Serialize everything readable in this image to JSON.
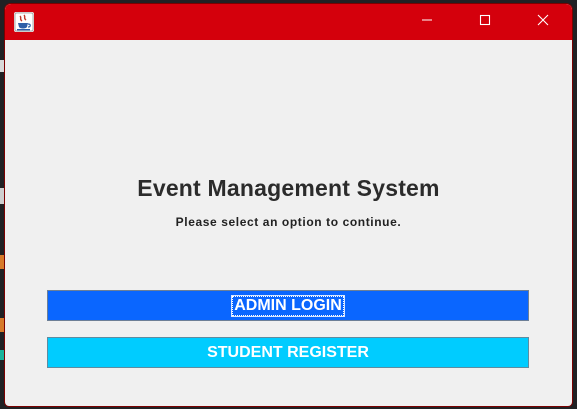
{
  "window": {
    "title": "",
    "titlebar_color": "#d4000c",
    "controls": {
      "minimize_icon": "minimize-icon",
      "maximize_icon": "maximize-icon",
      "close_icon": "close-icon"
    },
    "app_icon": "java-app-icon"
  },
  "main": {
    "heading": "Event Management System",
    "subtitle": "Please select an option to continue.",
    "buttons": {
      "admin_login": "ADMIN LOGIN",
      "student_register": "STUDENT REGISTER"
    }
  },
  "colors": {
    "admin_button": "#0a66ff",
    "student_button": "#00ccff",
    "background": "#f0f0f0"
  }
}
